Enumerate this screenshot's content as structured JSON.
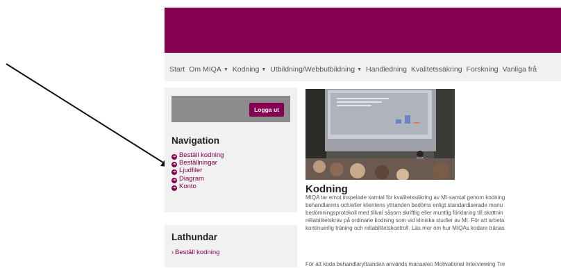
{
  "nav": {
    "items": [
      {
        "label": "Start",
        "dropdown": false
      },
      {
        "label": "Om MIQA",
        "dropdown": true
      },
      {
        "label": "Kodning",
        "dropdown": true
      },
      {
        "label": "Utbildning/Webbutbildning",
        "dropdown": true
      },
      {
        "label": "Handledning",
        "dropdown": false
      },
      {
        "label": "Kvalitetssäkring",
        "dropdown": false
      },
      {
        "label": "Forskning",
        "dropdown": false
      },
      {
        "label": "Vanliga frå",
        "dropdown": false
      }
    ]
  },
  "sidebar": {
    "logout_label": "Logga ut",
    "navigation": {
      "title": "Navigation",
      "items": [
        "Beställ kodning",
        "Beställningar",
        "Ljudfiler",
        "Diagram",
        "Konto"
      ]
    },
    "lathundar": {
      "title": "Lathundar",
      "items": [
        "Beställ kodning"
      ]
    }
  },
  "main": {
    "title": "Kodning",
    "paragraph1": [
      "MIQA tar emot inspelade samtal för kvalitetssäkring av MI-samtal genom kodning",
      "behandlarens och/eller klientens yttranden bedöms enligt standardiserade manu",
      "bedömningsprotokoll med tillval såsom skriftlig eller muntlig förklaring till skattnin",
      "reliabilitetskrav på ordinarie kodning som vid kliniska studier av MI. För att arbeta",
      "kontinuerlig träning och reliabilitetskontroll. Läs mer om hur MIQAs kodare tränas"
    ],
    "paragraph2": "För att koda behandlaryttranden används manualen Motivational Interviewing Tre"
  },
  "colors": {
    "brand": "#850050",
    "nav_bg": "#f1f1f1"
  }
}
